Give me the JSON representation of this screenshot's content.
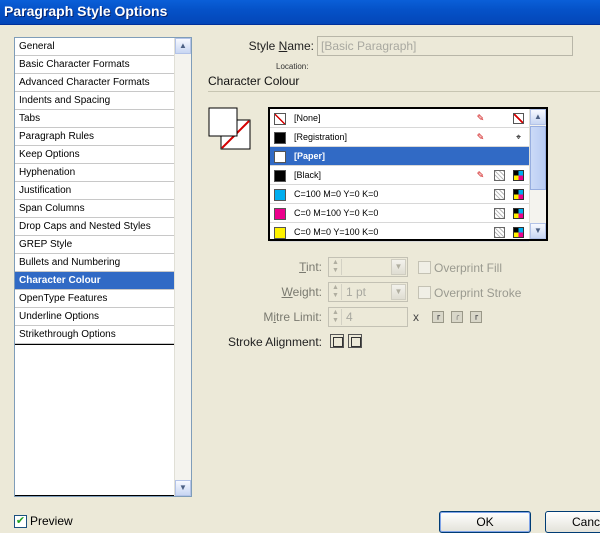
{
  "window": {
    "title": "Paragraph Style Options"
  },
  "categories": [
    "General",
    "Basic Character Formats",
    "Advanced Character Formats",
    "Indents and Spacing",
    "Tabs",
    "Paragraph Rules",
    "Keep Options",
    "Hyphenation",
    "Justification",
    "Span Columns",
    "Drop Caps and Nested Styles",
    "GREP Style",
    "Bullets and Numbering",
    "Character Colour",
    "OpenType Features",
    "Underline Options",
    "Strikethrough Options"
  ],
  "selected_category": "Character Colour",
  "style_name": {
    "label_prefix": "Style ",
    "label_underlined": "N",
    "label_suffix": "ame:",
    "value": "[Basic Paragraph]"
  },
  "location_label": "Location:",
  "section_title": "Character Colour",
  "swatches": [
    {
      "name": "[None]",
      "chip": "none",
      "icons": [
        "no-edit",
        "none"
      ]
    },
    {
      "name": "[Registration]",
      "chip": "#000000",
      "icons": [
        "no-edit",
        "registration"
      ]
    },
    {
      "name": "[Paper]",
      "chip": "#ffffff",
      "icons": [],
      "selected": true
    },
    {
      "name": "[Black]",
      "chip": "#000000",
      "icons": [
        "no-edit",
        "process",
        "cmyk"
      ]
    },
    {
      "name": "C=100 M=0 Y=0 K=0",
      "chip": "#00aeef",
      "icons": [
        "process",
        "cmyk"
      ]
    },
    {
      "name": "C=0 M=100 Y=0 K=0",
      "chip": "#ec008c",
      "icons": [
        "process",
        "cmyk"
      ]
    },
    {
      "name": "C=0 M=0 Y=100 K=0",
      "chip": "#fff200",
      "icons": [
        "process",
        "cmyk"
      ]
    }
  ],
  "tint": {
    "label_underlined": "T",
    "label_rest": "int:",
    "value": ""
  },
  "weight": {
    "label_underlined": "W",
    "label_rest": "eight:",
    "value": "1 pt"
  },
  "mitre_limit": {
    "label_prefix": "M",
    "label_underlined": "i",
    "label_rest": "tre Limit:",
    "value": "4",
    "suffix": "x"
  },
  "overprint_fill": "Overprint Fill",
  "overprint_stroke": "Overprint Stroke",
  "stroke_alignment_label": "Stroke Alignment:",
  "preview": {
    "label": "Preview",
    "checked": true
  },
  "buttons": {
    "ok": "OK",
    "cancel": "Canc"
  }
}
